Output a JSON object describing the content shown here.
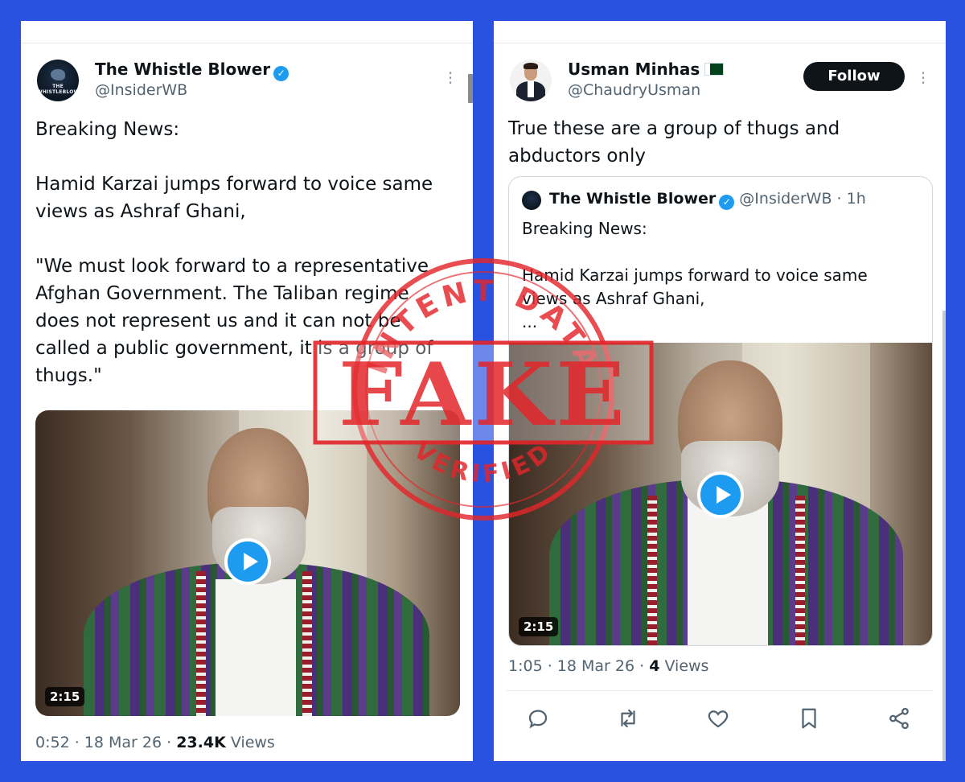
{
  "left_post": {
    "author": {
      "name": "The Whistle Blower",
      "handle": "@InsiderWB",
      "avatar_text": "THE WHISTLEBLOWER",
      "verified": true
    },
    "text": "Breaking News:\n\nHamid Karzai jumps forward to voice same views as Ashraf Ghani,\n\n\"We must look forward to a representative Afghan Government. The Taliban regime does not represent us and it can not be called a public government, it is a group of thugs.\"",
    "video_duration": "2:15",
    "timestamp": "0:52 · 18 Mar 26 · ",
    "views_count": "23.4K",
    "views_label": "Views",
    "more_icon": "more-vertical-icon"
  },
  "right_post": {
    "author": {
      "name": "Usman Minhas",
      "handle": "@ChaudryUsman",
      "flag": "pakistan-flag-icon"
    },
    "follow_label": "Follow",
    "text": "True these are a group of thugs and abductors only",
    "quote": {
      "name": "The Whistle Blower",
      "handle_time": "@InsiderWB · 1h",
      "text": "Breaking News:\n\nHamid Karzai jumps forward to voice same views as Ashraf Ghani,\n..."
    },
    "video_duration": "2:15",
    "timestamp": "1:05 · 18 Mar 26 · ",
    "views_count": "4",
    "views_label": "Views",
    "actions": [
      "reply-icon",
      "retweet-icon",
      "like-icon",
      "bookmark-icon",
      "share-icon"
    ]
  },
  "stamp": {
    "top_text": "INTENT DATA",
    "main_text": "FAKE",
    "bottom_text": "VERIFIED",
    "color": "#e3262b"
  },
  "colors": {
    "background": "#2a52e0",
    "verified": "#1d9bf0",
    "text": "#0f1419",
    "muted": "#536471"
  }
}
